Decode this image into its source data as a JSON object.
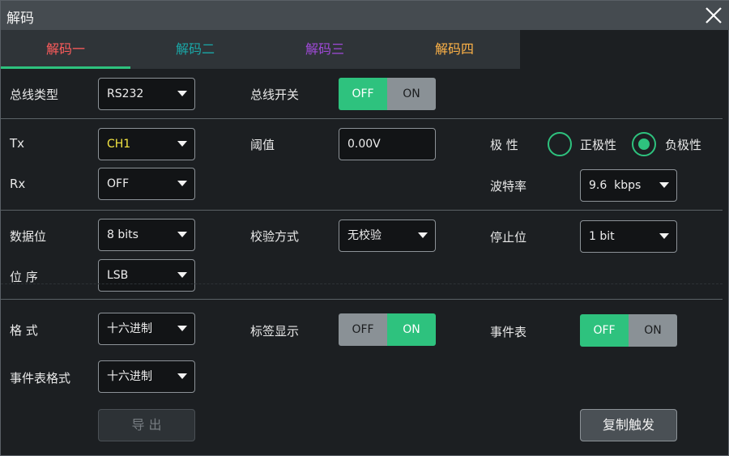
{
  "window": {
    "title": "解码"
  },
  "tabs": [
    {
      "label": "解码一",
      "color": "#ff5c5c",
      "active": true
    },
    {
      "label": "解码二",
      "color": "#1aa8a8"
    },
    {
      "label": "解码三",
      "color": "#a04ad8"
    },
    {
      "label": "解码四",
      "color": "#ffb347"
    }
  ],
  "bus": {
    "type_label": "总线类型",
    "type_value": "RS232",
    "switch_label": "总线开关",
    "switch_off": "OFF",
    "switch_on": "ON",
    "switch_state": "OFF"
  },
  "signals": {
    "tx_label": "Tx",
    "tx_value": "CH1",
    "tx_color": "#f5e642",
    "threshold_label": "阈值",
    "threshold_value": "0.00V",
    "polarity_label": "极 性",
    "polarity_positive": "正极性",
    "polarity_negative": "负极性",
    "polarity_selected": "负极性",
    "rx_label": "Rx",
    "rx_value": "OFF",
    "baud_label": "波特率",
    "baud_value": "9.6  kbps"
  },
  "frame": {
    "databits_label": "数据位",
    "databits_value": "8 bits",
    "parity_label": "校验方式",
    "parity_value": "无校验",
    "stopbits_label": "停止位",
    "stopbits_value": "1 bit",
    "bitorder_label": "位 序",
    "bitorder_value": "LSB"
  },
  "display": {
    "format_label": "格 式",
    "format_value": "十六进制",
    "tag_label": "标签显示",
    "tag_off": "OFF",
    "tag_on": "ON",
    "tag_state": "ON",
    "eventtable_label": "事件表",
    "eventtable_off": "OFF",
    "eventtable_on": "ON",
    "eventtable_state": "OFF",
    "eventformat_label": "事件表格式",
    "eventformat_value": "十六进制"
  },
  "actions": {
    "export_label": "导 出",
    "copy_trigger_label": "复制触发"
  },
  "colors": {
    "accent": "#2ec27e",
    "toggle_off": "#8a9196"
  }
}
